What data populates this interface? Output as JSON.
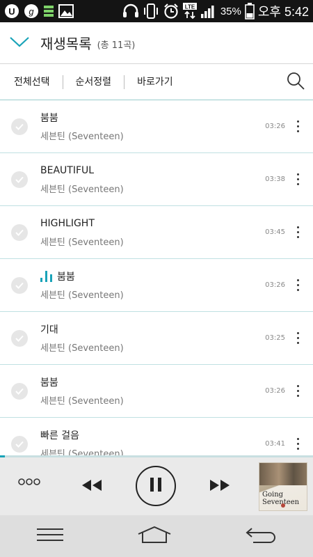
{
  "status_bar": {
    "battery_percent": "35%",
    "network": "LTE",
    "time": "오후 5:42",
    "icons": [
      "uplus-icon",
      "g-icon",
      "battery-stack-icon",
      "image-icon",
      "headset-icon",
      "vibrate-icon",
      "alarm-icon",
      "lte-icon",
      "signal-icon",
      "battery-icon"
    ]
  },
  "header": {
    "title": "재생목록",
    "count": "(총 11곡)"
  },
  "toolbar": {
    "select_all": "전체선택",
    "sort": "순서정렬",
    "goto": "바로가기"
  },
  "songs": [
    {
      "title": "붐붐",
      "artist": "세븐틴 (Seventeen)",
      "duration": "03:26",
      "playing": false
    },
    {
      "title": "BEAUTIFUL",
      "artist": "세븐틴 (Seventeen)",
      "duration": "03:38",
      "playing": false
    },
    {
      "title": "HIGHLIGHT",
      "artist": "세븐틴 (Seventeen)",
      "duration": "03:45",
      "playing": false
    },
    {
      "title": "붐붐",
      "artist": "세븐틴 (Seventeen)",
      "duration": "03:26",
      "playing": true
    },
    {
      "title": "기대",
      "artist": "세븐틴 (Seventeen)",
      "duration": "03:25",
      "playing": false
    },
    {
      "title": "붐붐",
      "artist": "세븐틴 (Seventeen)",
      "duration": "03:26",
      "playing": false
    },
    {
      "title": "빠른 걸음",
      "artist": "세븐틴 (Seventeen)",
      "duration": "03:41",
      "playing": false
    }
  ],
  "player": {
    "progress": 0.015,
    "album_title_line1": "Going",
    "album_title_line2": "Seventeen",
    "accent_color": "#19a3b8"
  },
  "colors": {
    "status_bar_bg": "#141414",
    "accent": "#19a3b8",
    "player_bg": "#eaeaea",
    "nav_bg": "#dedede"
  }
}
